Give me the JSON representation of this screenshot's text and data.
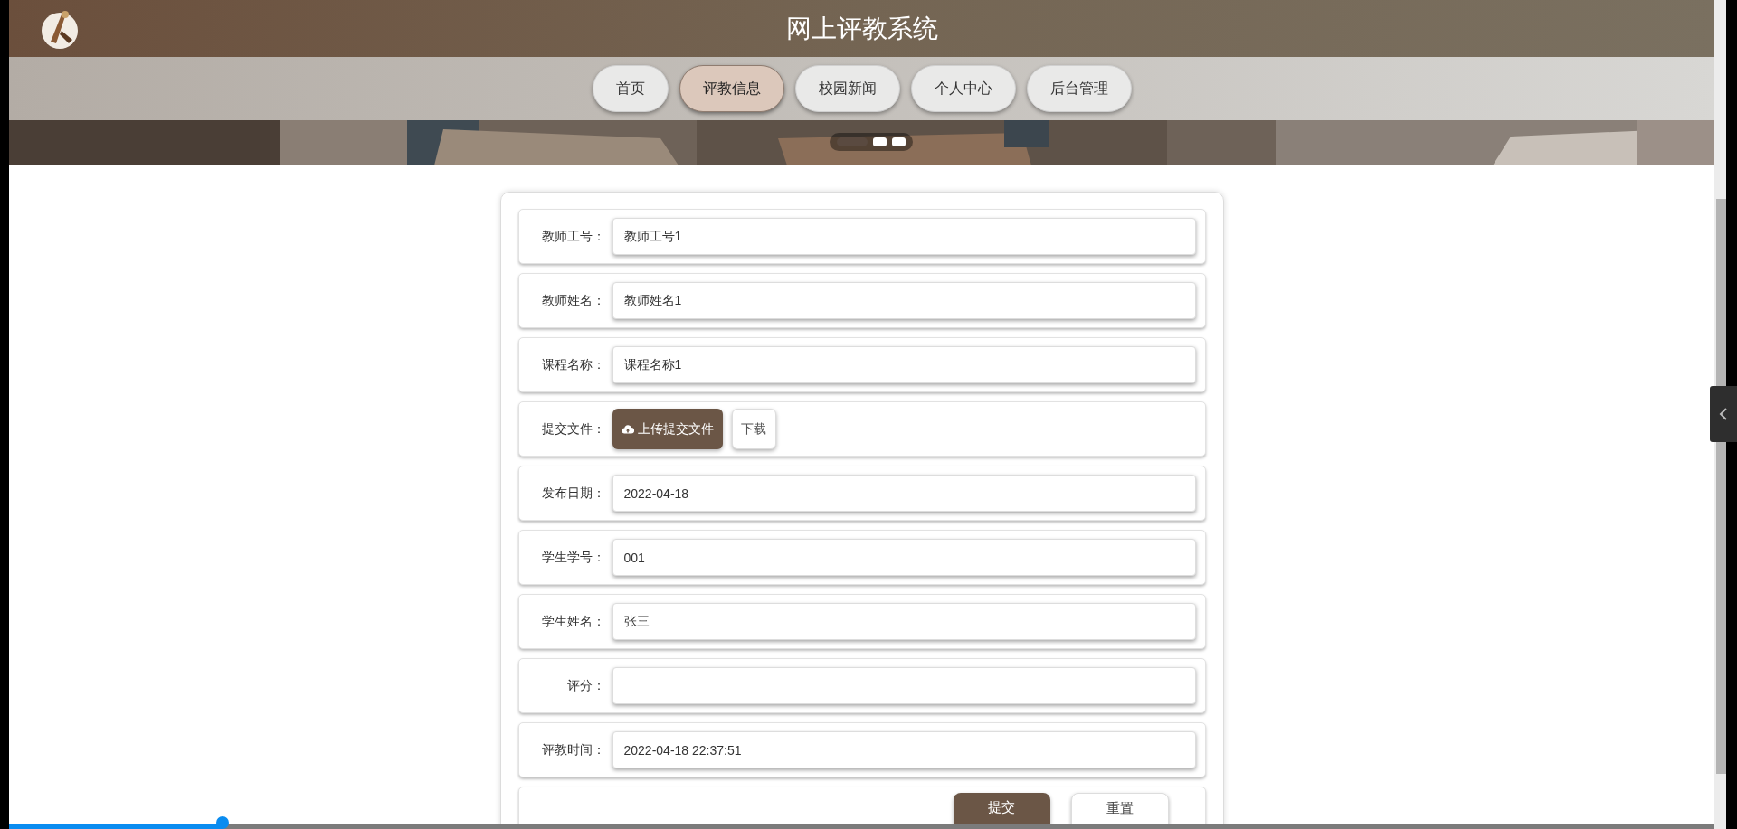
{
  "header": {
    "title": "网上评教系统"
  },
  "nav": [
    {
      "label": "首页",
      "selected": false
    },
    {
      "label": "评教信息",
      "selected": true
    },
    {
      "label": "校园新闻",
      "selected": false
    },
    {
      "label": "个人中心",
      "selected": false
    },
    {
      "label": "后台管理",
      "selected": false
    }
  ],
  "banner": {
    "dots": [
      {
        "selected": true
      },
      {
        "selected": false
      },
      {
        "selected": false
      }
    ]
  },
  "form": {
    "rows": [
      {
        "kind": "input",
        "label": "教师工号：",
        "value": "教师工号1"
      },
      {
        "kind": "input",
        "label": "教师姓名：",
        "value": "教师姓名1"
      },
      {
        "kind": "input",
        "label": "课程名称：",
        "value": "课程名称1"
      },
      {
        "kind": "file",
        "label": "提交文件：",
        "upload": "上传提交文件",
        "download": "下载"
      },
      {
        "kind": "input",
        "label": "发布日期：",
        "value": "2022-04-18"
      },
      {
        "kind": "input",
        "label": "学生学号：",
        "value": "001"
      },
      {
        "kind": "input",
        "label": "学生姓名：",
        "value": "张三"
      },
      {
        "kind": "input",
        "label": "评分：",
        "value": ""
      },
      {
        "kind": "input",
        "label": "评教时间：",
        "value": "2022-04-18 22:37:51"
      }
    ],
    "buttons": [
      {
        "kind": "primary",
        "label": "提交"
      },
      {
        "kind": "secondary",
        "label": "重置"
      }
    ]
  },
  "progress_bar": {
    "level": 0.125
  }
}
